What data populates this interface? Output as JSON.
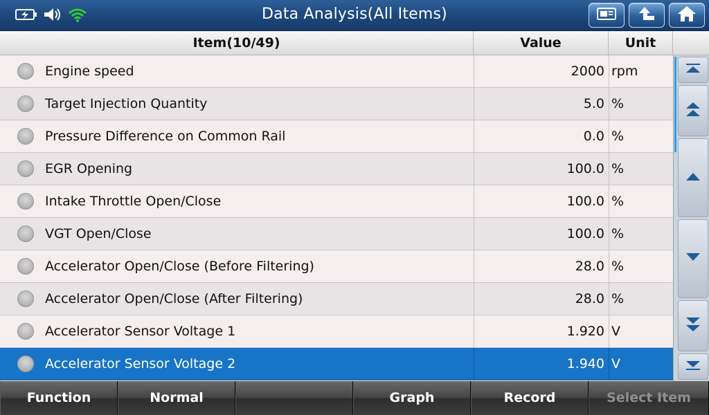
{
  "header": {
    "title": "Data Analysis(All Items)",
    "icons": [
      "battery-icon",
      "speaker-icon",
      "wifi-icon"
    ],
    "buttons": [
      "report-icon",
      "back-arrow-icon",
      "home-icon"
    ]
  },
  "table": {
    "columns": {
      "item": "Item(10/49)",
      "value": "Value",
      "unit": "Unit"
    },
    "rows": [
      {
        "name": "Engine speed",
        "value": "2000",
        "unit": "rpm"
      },
      {
        "name": "Target Injection Quantity",
        "value": "5.0",
        "unit": "%"
      },
      {
        "name": "Pressure Difference on Common Rail",
        "value": "0.0",
        "unit": "%"
      },
      {
        "name": "EGR Opening",
        "value": "100.0",
        "unit": "%"
      },
      {
        "name": "Intake Throttle Open/Close",
        "value": "100.0",
        "unit": "%"
      },
      {
        "name": "VGT Open/Close",
        "value": "100.0",
        "unit": "%"
      },
      {
        "name": "Accelerator Open/Close (Before Filtering)",
        "value": "28.0",
        "unit": "%"
      },
      {
        "name": "Accelerator Open/Close (After Filtering)",
        "value": "28.0",
        "unit": "%"
      },
      {
        "name": "Accelerator Sensor Voltage 1",
        "value": "1.920",
        "unit": "V"
      },
      {
        "name": "Accelerator Sensor Voltage 2",
        "value": "1.940",
        "unit": "V"
      }
    ],
    "selected_row": "Accelerator Sensor Voltage 2"
  },
  "scroll_buttons": [
    "scroll-top-icon",
    "page-up-icon",
    "up-arrow-icon",
    "down-arrow-icon",
    "page-down-icon",
    "scroll-bottom-icon"
  ],
  "bottom_bar": {
    "function": "Function",
    "normal": "Normal",
    "blank": "",
    "graph": "Graph",
    "record": "Record",
    "select_item": "Select Item"
  },
  "colors": {
    "title_bar": "#1f4a80",
    "selected_row": "#1874c6",
    "accent_wifi": "#33cc33"
  }
}
